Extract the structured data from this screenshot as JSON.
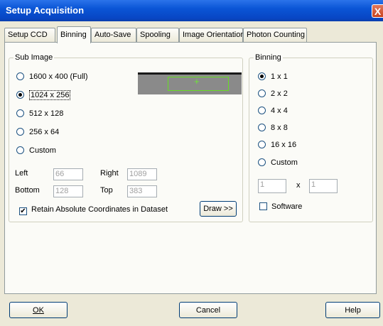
{
  "window": {
    "title": "Setup Acquisition",
    "close_glyph": "X"
  },
  "tabs": [
    {
      "label": "Setup CCD",
      "active": false
    },
    {
      "label": "Binning",
      "active": true
    },
    {
      "label": "Auto-Save",
      "active": false
    },
    {
      "label": "Spooling",
      "active": false
    },
    {
      "label": "Image Orientation",
      "active": false
    },
    {
      "label": "Photon Counting",
      "active": false
    }
  ],
  "sub_image": {
    "title": "Sub Image",
    "options": [
      "1600 x 400 (Full)",
      "1024 x 256",
      "512 x 128",
      "256 x 64",
      "Custom"
    ],
    "selected_index": 1,
    "left_label": "Left",
    "left_value": "66",
    "right_label": "Right",
    "right_value": "1089",
    "bottom_label": "Bottom",
    "bottom_value": "128",
    "top_label": "Top",
    "top_value": "383",
    "retain_label": "Retain Absolute Coordinates in Dataset",
    "retain_checked": true,
    "draw_label": "Draw >>"
  },
  "binning": {
    "title": "Binning",
    "options": [
      "1 x 1",
      "2 x 2",
      "4 x 4",
      "8 x 8",
      "16 x 16",
      "Custom"
    ],
    "selected_index": 0,
    "custom_x": "1",
    "times_label": "x",
    "custom_y": "1",
    "software_label": "Software",
    "software_checked": false
  },
  "buttons": {
    "ok": "OK",
    "cancel": "Cancel",
    "help": "Help"
  },
  "colors": {
    "title_bar": "#0a55d6",
    "dialog_bg": "#ECE9D8",
    "panel_bg": "#FBFBF7",
    "close_red": "#D2532F"
  },
  "icons": {
    "check": "✔",
    "roi_marker": "+"
  }
}
